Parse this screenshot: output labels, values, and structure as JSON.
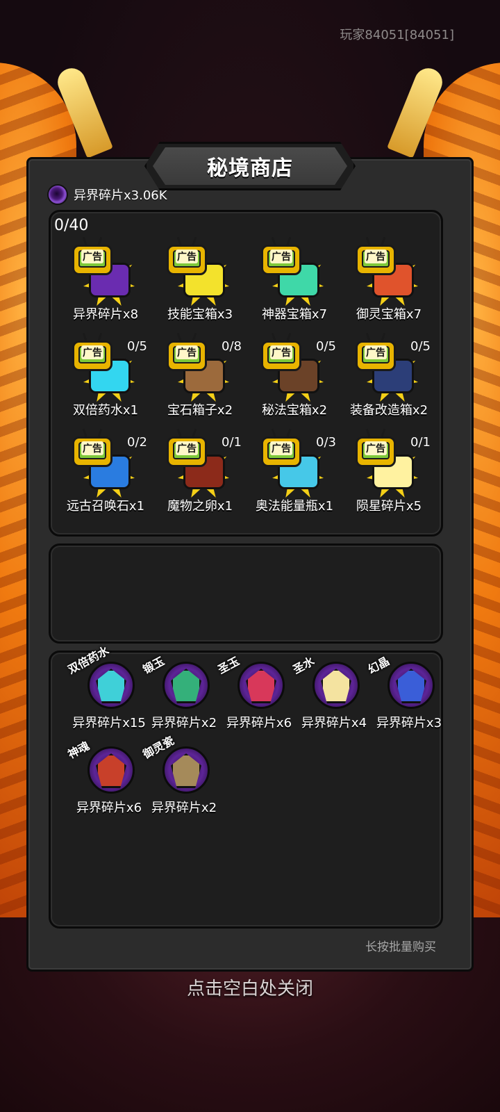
{
  "header": {
    "player_id": "玩家84051[84051]"
  },
  "shop": {
    "title": "秘境商店",
    "currency": {
      "icon": "void-shard-icon",
      "label": "异界碎片x3.06K"
    },
    "ad_counter": "0/40",
    "ad_badge": "广告",
    "ad_items": [
      {
        "name": "异界碎片x8",
        "limit": "",
        "icon": "void-shard-icon",
        "color": "#6a2cb0"
      },
      {
        "name": "技能宝箱x3",
        "limit": "",
        "icon": "skill-chest-icon",
        "color": "#f3e22c"
      },
      {
        "name": "神器宝箱x7",
        "limit": "",
        "icon": "artifact-chest-icon",
        "color": "#3fd8a8"
      },
      {
        "name": "御灵宝箱x7",
        "limit": "",
        "icon": "spirit-chest-icon",
        "color": "#e0532c"
      },
      {
        "name": "双倍药水x1",
        "limit": "0/5",
        "icon": "double-potion-icon",
        "color": "#33d6f0"
      },
      {
        "name": "宝石箱子x2",
        "limit": "0/8",
        "icon": "gem-bag-icon",
        "color": "#9c6a3c"
      },
      {
        "name": "秘法宝箱x2",
        "limit": "0/5",
        "icon": "arcane-chest-icon",
        "color": "#6b4228"
      },
      {
        "name": "装备改造箱x2",
        "limit": "0/5",
        "icon": "equipment-box-icon",
        "color": "#2c3e78"
      },
      {
        "name": "远古召唤石x1",
        "limit": "0/2",
        "icon": "summon-stone-icon",
        "color": "#2a7ce0"
      },
      {
        "name": "魔物之卵x1",
        "limit": "0/1",
        "icon": "monster-egg-icon",
        "color": "#8c2a1a"
      },
      {
        "name": "奥法能量瓶x1",
        "limit": "0/3",
        "icon": "energy-bottle-icon",
        "color": "#46c8e8"
      },
      {
        "name": "陨星碎片x5",
        "limit": "0/1",
        "icon": "meteor-shard-icon",
        "color": "#fff2a0"
      }
    ],
    "exchange_items": [
      {
        "tag": "双倍药水",
        "price": "异界碎片x15",
        "icon": "hourglass-potion-icon",
        "color": "#3fd0d8"
      },
      {
        "tag": "锻玉",
        "price": "异界碎片x2",
        "icon": "forge-jade-icon",
        "color": "#34b07a"
      },
      {
        "tag": "圣玉",
        "price": "异界碎片x6",
        "icon": "holy-jade-icon",
        "color": "#d8385a"
      },
      {
        "tag": "圣水",
        "price": "异界碎片x4",
        "icon": "holy-water-icon",
        "color": "#f4e3a0"
      },
      {
        "tag": "幻晶",
        "price": "异界碎片x3",
        "icon": "phantom-crystal-icon",
        "color": "#3a5ed8"
      },
      {
        "tag": "神魂",
        "price": "异界碎片x6",
        "icon": "divine-soul-icon",
        "color": "#c8402a"
      },
      {
        "tag": "御灵瓷",
        "price": "异界碎片x2",
        "icon": "spirit-vase-icon",
        "color": "#a58a5a"
      }
    ],
    "bulk_hint": "长按批量购买",
    "close_hint": "点击空白处关闭"
  }
}
